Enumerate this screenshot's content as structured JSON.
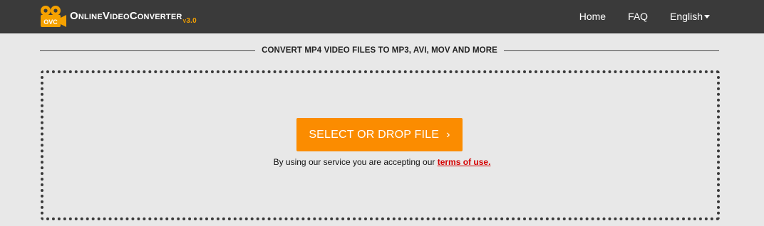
{
  "header": {
    "logo": {
      "icon_text": "OVC",
      "brand_name": "OnlineVideoConverter",
      "version": "v3.0",
      "accent_color": "#f5a100"
    },
    "nav": {
      "home": "Home",
      "faq": "FAQ",
      "language": "English"
    }
  },
  "main": {
    "headline": "CONVERT MP4 VIDEO FILES TO MP3, AVI, MOV AND MORE",
    "select_button_label": "SELECT OR DROP FILE",
    "select_button_chevron": "›",
    "select_button_color": "#fb8c00",
    "terms_prefix": "By using our service you are accepting our",
    "terms_link": "terms of use."
  }
}
